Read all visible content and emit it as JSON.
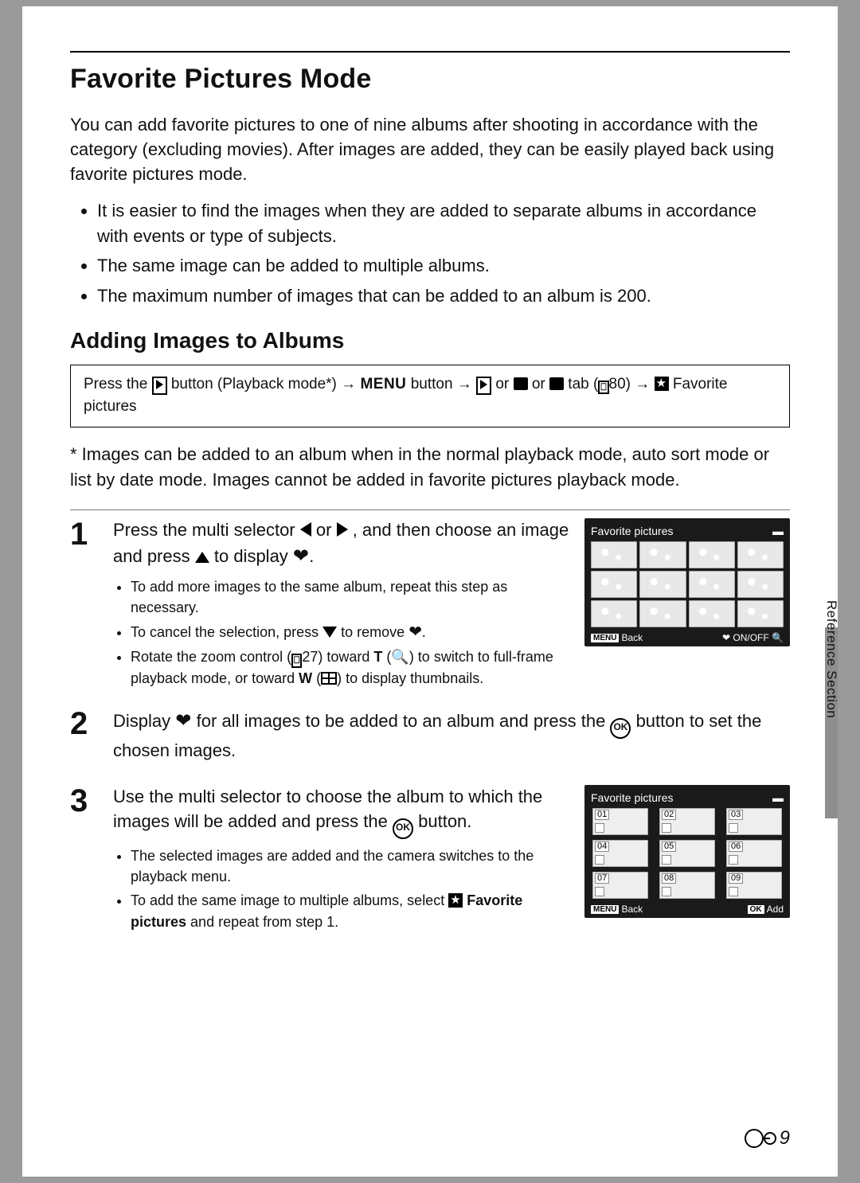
{
  "sidebar_label": "Reference Section",
  "page_number": "9",
  "title": "Favorite Pictures Mode",
  "intro": "You can add favorite pictures to one of nine albums after shooting in accordance with the category (excluding movies). After images are added, they can be easily played back using favorite pictures mode.",
  "bullets": [
    "It is easier to find the images when they are added to separate albums in accordance with events or type of subjects.",
    "The same image can be added to multiple albums.",
    "The maximum number of images that can be added to an album is 200."
  ],
  "subheading": "Adding Images to Albums",
  "flow": {
    "press_the": "Press the ",
    "playback_mode": " button (Playback mode*) ",
    "menu": "MENU",
    "button": " button ",
    "or": " or ",
    "tab_ref": " tab (",
    "tab_pg": "80",
    "end": ")  ",
    "fav_line": "Favorite pictures"
  },
  "footnote": "*  Images can be added to an album when in the normal playback mode, auto sort mode or list by date mode. Images cannot be added in favorite pictures playback mode.",
  "steps": {
    "s1": {
      "num": "1",
      "lead_a": "Press the multi selector ",
      "lead_or": " or ",
      "lead_b": ", and then choose an image and press ",
      "lead_c": " to display ",
      "lead_end": ".",
      "b1": "To add more images to the same album, repeat this step as necessary.",
      "b2a": "To cancel the selection, press ",
      "b2b": " to remove ",
      "b2c": ".",
      "b3a": "Rotate the zoom control (",
      "b3pg": "27",
      "b3b": ") toward ",
      "b3T": "T",
      "b3c": " (",
      "b3d": ") to switch to full-frame playback mode, or toward ",
      "b3W": "W",
      "b3e": " (",
      "b3f": ") to display thumbnails."
    },
    "s2": {
      "num": "2",
      "lead_a": "Display ",
      "lead_b": " for all images to be added to an album and press the ",
      "lead_c": " button to set the chosen images."
    },
    "s3": {
      "num": "3",
      "lead_a": "Use the multi selector to choose the album to which the images will be added and press the ",
      "lead_b": " button.",
      "b1": "The selected images are added and the camera switches to the playback menu.",
      "b2a": "To add the same image to multiple albums, select ",
      "b2b": "Favorite pictures",
      "b2c": " and repeat from step 1."
    }
  },
  "lcd1": {
    "title": "Favorite pictures",
    "back": "Back",
    "onoff": "ON/OFF",
    "menu": "MENU"
  },
  "lcd2": {
    "title": "Favorite pictures",
    "albums": [
      "01",
      "02",
      "03",
      "04",
      "05",
      "06",
      "07",
      "08",
      "09"
    ],
    "back": "Back",
    "add": "Add",
    "menu": "MENU",
    "ok": "OK"
  }
}
